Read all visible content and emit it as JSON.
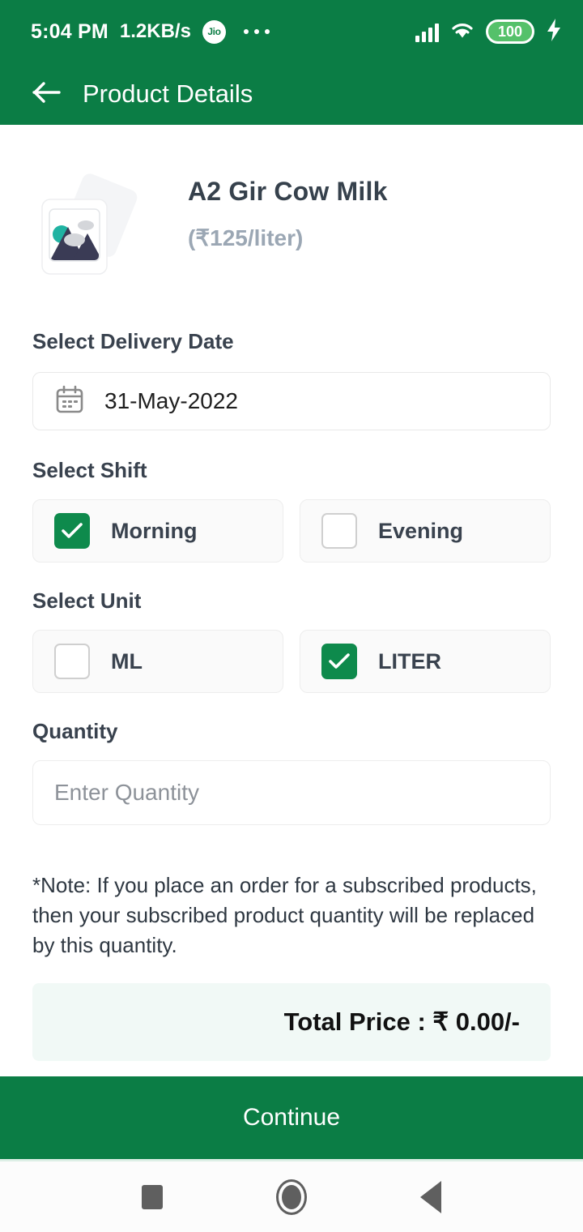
{
  "status_bar": {
    "time": "5:04 PM",
    "network_speed": "1.2KB/s",
    "carrier": "Jio",
    "overflow_icon": "more-dots-icon",
    "signal_icon": "signal-bars-icon",
    "wifi_icon": "wifi-icon",
    "battery_level": "100",
    "charging_icon": "lightning-bolt-icon"
  },
  "app_bar": {
    "back_icon": "back-arrow-icon",
    "title": "Product Details",
    "background_color": "#0B7D45"
  },
  "product": {
    "image_placeholder_icon": "image-placeholder-icon",
    "name": "A2 Gir Cow Milk",
    "price_label": "(₹125/liter)"
  },
  "delivery_date": {
    "label": "Select Delivery Date",
    "calendar_icon": "calendar-icon",
    "value": "31-May-2022"
  },
  "shift": {
    "label": "Select Shift",
    "options": [
      {
        "label": "Morning",
        "checked": true
      },
      {
        "label": "Evening",
        "checked": false
      }
    ]
  },
  "unit": {
    "label": "Select Unit",
    "options": [
      {
        "label": "ML",
        "checked": false
      },
      {
        "label": "LITER",
        "checked": true
      }
    ]
  },
  "quantity": {
    "label": "Quantity",
    "placeholder": "Enter Quantity",
    "value": ""
  },
  "note": "*Note: If you place an order for a subscribed products, then your subscribed product quantity will be replaced by this quantity.",
  "total": {
    "text": "Total Price : ₹ 0.00/-"
  },
  "continue_button": {
    "label": "Continue"
  },
  "nav_bar": {
    "recents_icon": "recents-square-icon",
    "home_icon": "home-circle-icon",
    "back_icon": "back-triangle-icon"
  },
  "colors": {
    "brand_green": "#0B7D45",
    "checkbox_green": "#0E8A4C",
    "total_card": "#F1F9F6",
    "price_grey": "#9BA7B4"
  }
}
